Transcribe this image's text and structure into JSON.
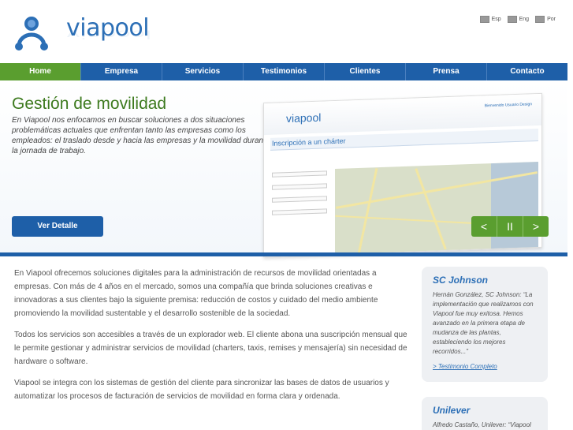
{
  "header": {
    "logo_text": "viapool",
    "languages": [
      {
        "label": "Esp"
      },
      {
        "label": "Eng"
      },
      {
        "label": "Por"
      }
    ]
  },
  "nav": {
    "items": [
      {
        "label": "Home",
        "active": true
      },
      {
        "label": "Empresa"
      },
      {
        "label": "Servicios"
      },
      {
        "label": "Testimonios"
      },
      {
        "label": "Clientes"
      },
      {
        "label": "Prensa"
      },
      {
        "label": "Contacto"
      }
    ]
  },
  "hero": {
    "title": "Gestión de movilidad",
    "text": "En Viapool nos enfocamos en buscar soluciones a dos situaciones problemáticas actuales que enfrentan tanto las empresas como los empleados: el traslado desde y hacia las empresas y la movilidad durante la jornada de trabajo.",
    "button": "Ver Detalle",
    "screenshot": {
      "logo": "viapool",
      "user": "Bienvenido Usuario Design",
      "title": "Inscripción a un chárter"
    },
    "controls": [
      "<",
      "II",
      ">"
    ]
  },
  "main": {
    "paragraphs": [
      "En Viapool ofrecemos soluciones digitales para la administración de recursos de movilidad orientadas a empresas. Con más de 4 años en el mercado, somos una compañía que brinda soluciones creativas e innovadoras a sus clientes bajo la siguiente premisa: reducción de costos y cuidado del medio ambiente promoviendo la movilidad sustentable y el desarrollo sostenible de la sociedad.",
      "Todos los servicios son accesibles a través de un explorador web. El cliente abona una suscripción mensual que le permite gestionar y administrar servicios de movilidad (charters, taxis, remises y mensajería) sin necesidad de hardware o software.",
      "Viapool se integra con los sistemas de gestión del cliente para sincronizar las bases de datos de usuarios y automatizar los procesos de facturación de servicios de movilidad en forma clara y ordenada."
    ]
  },
  "sidebar": {
    "testimonials": [
      {
        "company": "SC Johnson",
        "text": "Hernán González, SC Johnson: “La implementación que realizamos con Viapool fue muy exitosa. Hemos avanzado en la primera etapa de mudanza de las plantas, estableciendo los mejores recorridos...”",
        "link": "> Testimonio Completo"
      },
      {
        "company": "Unilever",
        "text": "Alfredo Castaño, Unilever: “Viapool"
      }
    ]
  },
  "colors": {
    "brand_blue": "#1e5fa8",
    "brand_green": "#5a9e2f"
  }
}
